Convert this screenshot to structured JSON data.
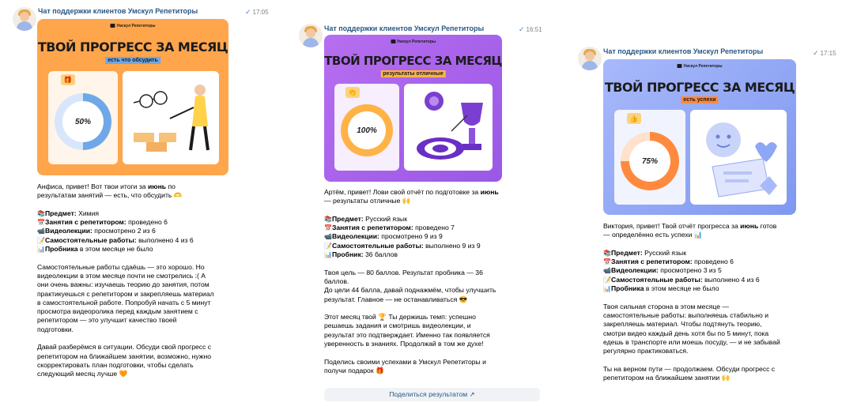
{
  "messages": [
    {
      "sender": "Чат поддержки клиентов Умскул Репетиторы",
      "time": "17:05",
      "card": {
        "logo": "Умскул Репетиторы",
        "title": "ТВОЙ ПРОГРЕСС ЗА МЕСЯЦ",
        "subtitle": "есть что обсудить",
        "percent": "50%",
        "progress": 0.5,
        "bg": "#ffa64d",
        "accent": "#6fa8e8"
      },
      "lines": [
        {
          "k": "Анфиса, привет! Вот твои итоги за ",
          "b": "июнь",
          "t": " по"
        },
        {
          "t": "результатам занятий — есть, что обсудить 🫶"
        },
        {
          "gap": true
        },
        {
          "e": "📚",
          "b": "Предмет:",
          "t": " Химия"
        },
        {
          "e": "📅",
          "b": "Занятия с репетитором:",
          "t": " проведено 6"
        },
        {
          "e": "📹",
          "b": "Видеолекции:",
          "t": " просмотрено 2 из 6"
        },
        {
          "e": "📝",
          "b": "Самостоятельные работы:",
          "t": " выполнено 4 из 6"
        },
        {
          "e": "📊",
          "b": "Пробника",
          "t": " в этом месяце не было"
        },
        {
          "gap": true
        },
        {
          "t": "Самостоятельные работы сдаёшь — это хорошо. Но"
        },
        {
          "t": "видеолекции в этом месяце почти не смотрелись :( А"
        },
        {
          "t": "они очень важны: изучаешь теорию до занятия, потом"
        },
        {
          "t": "практикуешься с репетитором и закрепляешь материал"
        },
        {
          "t": "в самостоятельной работе. Попробуй начать с 5 минут"
        },
        {
          "t": "просмотра видеоролика перед каждым занятием с"
        },
        {
          "t": "репетитором — это улучшит качество твоей"
        },
        {
          "t": "подготовки."
        },
        {
          "gap": true
        },
        {
          "t": "Давай разберёмся в ситуации. Обсуди свой прогресс с"
        },
        {
          "t": "репетитором на ближайшем занятии, возможно, нужно"
        },
        {
          "t": "скорректировать план подготовки, чтобы сделать"
        },
        {
          "t": "следующий месяц лучше 🧡"
        }
      ]
    },
    {
      "sender": "Чат поддержки клиентов Умскул Репетиторы",
      "time": "16:51",
      "card": {
        "logo": "Умскул Репетиторы",
        "title": "ТВОЙ ПРОГРЕСС ЗА МЕСЯЦ",
        "subtitle": "результаты отличные",
        "percent": "100%",
        "progress": 1.0,
        "bg": "#a861ea",
        "accent": "#ffb347"
      },
      "lines": [
        {
          "k": "Артём, привет! Лови свой отчёт по подготовке за ",
          "b": "июнь"
        },
        {
          "t": "— результаты отличные 🙌"
        },
        {
          "gap": true
        },
        {
          "e": "📚",
          "b": "Предмет:",
          "t": " Русский язык"
        },
        {
          "e": "📅",
          "b": "Занятия с репетитором:",
          "t": " проведено 7"
        },
        {
          "e": "📹",
          "b": "Видеолекции:",
          "t": " просмотрено 9 из 9"
        },
        {
          "e": "📝",
          "b": "Самостоятельные работы:",
          "t": " выполнено 9 из 9"
        },
        {
          "e": "📊",
          "b": "Пробник:",
          "t": " 36 баллов"
        },
        {
          "gap": true
        },
        {
          "t": "Твоя цель — 80 баллов. Результат пробника — 36"
        },
        {
          "t": "баллов."
        },
        {
          "t": "До цели 44 балла, давай поднажмём, чтобы улучшить"
        },
        {
          "t": "результат. Главное — не останавливаться 😎"
        },
        {
          "gap": true
        },
        {
          "t": "Этот месяц твой 🏆 Ты держишь темп: успешно"
        },
        {
          "t": "решаешь задания и смотришь видеолекции, и"
        },
        {
          "t": "результат это подтверждает. Именно так появляется"
        },
        {
          "t": "уверенность в знаниях. Продолжай в том же духе!"
        },
        {
          "gap": true
        },
        {
          "t": "Поделись своими успехами в Умскул Репетиторы и"
        },
        {
          "t": "получи подарок 🎁"
        }
      ],
      "share_button": "Поделиться результатом ↗"
    },
    {
      "sender": "Чат поддержки клиентов Умскул Репетиторы",
      "time": "17:15",
      "card": {
        "logo": "Умскул Репетиторы",
        "title": "ТВОЙ ПРОГРЕСС ЗА МЕСЯЦ",
        "subtitle": "есть успехи",
        "percent": "75%",
        "progress": 0.75,
        "bg": "#8ea7f5",
        "accent": "#ff8a3d"
      },
      "lines": [
        {
          "k": "Виктория, привет! Твой отчёт прогресса за ",
          "b": "июнь",
          "t": " готов"
        },
        {
          "t": "— определённо есть успехи 📊"
        },
        {
          "gap": true
        },
        {
          "e": "📚",
          "b": "Предмет:",
          "t": " Русский язык"
        },
        {
          "e": "📅",
          "b": "Занятия с репетитором:",
          "t": " проведено 6"
        },
        {
          "e": "📹",
          "b": "Видеолекции:",
          "t": " просмотрено 3 из 5"
        },
        {
          "e": "📝",
          "b": "Самостоятельные работы:",
          "t": " выполнено 4 из 6"
        },
        {
          "e": "📊",
          "b": "Пробника",
          "t": " в этом месяце не было"
        },
        {
          "gap": true
        },
        {
          "t": "Твоя сильная сторона в этом месяце —"
        },
        {
          "t": "самостоятельные работы: выполняешь стабильно и"
        },
        {
          "t": "закрепляешь материал. Чтобы подтянуть теорию,"
        },
        {
          "t": "смотри видео каждый день хотя бы по 5 минут, пока"
        },
        {
          "t": "едешь в транспорте или моешь посуду, — и не забывай"
        },
        {
          "t": "регулярно практиковаться."
        },
        {
          "gap": true
        },
        {
          "t": "Ты на верном пути — продолжаем. Обсуди прогресс с"
        },
        {
          "t": "репетитором на ближайшем занятии 🙌"
        }
      ]
    }
  ]
}
